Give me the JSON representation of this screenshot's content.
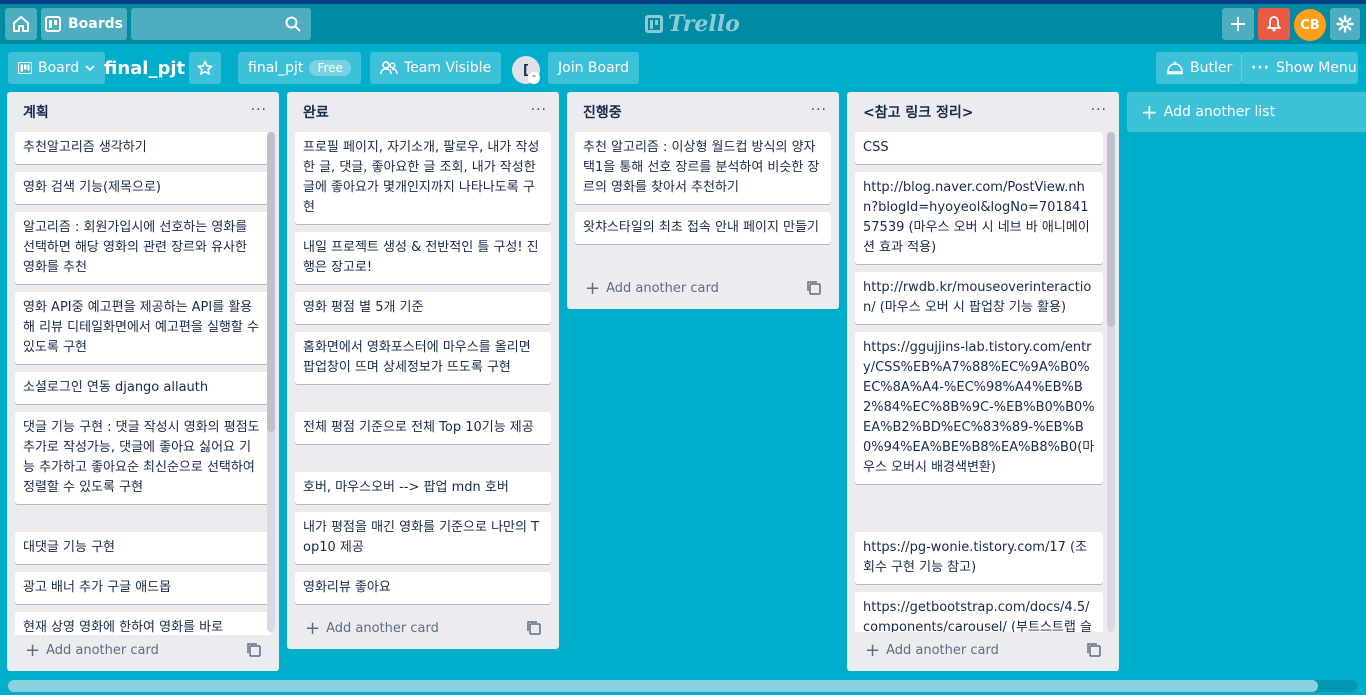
{
  "header": {
    "boards_label": "Boards",
    "search_placeholder": "",
    "logo_text": "Trello",
    "user_initials": "CB"
  },
  "boardbar": {
    "view_label": "Board",
    "board_name": "final_pjt",
    "team_label": "final_pjt",
    "plan_badge": "Free",
    "visibility_label": "Team Visible",
    "member_initial": "[",
    "join_label": "Join Board",
    "butler_label": "Butler",
    "menu_label": "Show Menu"
  },
  "lists": [
    {
      "title": "계획",
      "cards": [
        "추천알고리즘 생각하기",
        "영화 검색 기능(제목으로)",
        "알고리즘 : 회원가입시에 선호하는 영화를 선택하면 해당 영화의 관련 장르와 유사한 영화를 추천",
        "영화 API중 예고편을 제공하는 API를 활용해 리뷰 디테일화면에서 예고편을 실행할 수 있도록 구현",
        "소셜로그인 연동 django allauth",
        "댓글 기능 구현 : 댓글 작성시 영화의 평점도 추가로 작성가능, 댓글에 좋아요 싫어요 기능 추가하고 좋아요순 최신순으로 선택하여 정렬할 수 있도록 구현",
        "대댓글 기능 구현",
        "광고 배너 추가 구글 애드몹",
        "현재 상영 영화에 한하여 영화를 바로"
      ],
      "add_card_label": "Add another card"
    },
    {
      "title": "완료",
      "cards": [
        "프로필 페이지, 자기소개, 팔로우, 내가 작성한 글, 댓글, 좋아요한 글 조회, 내가 작성한 글에 좋아요가 몇개인지까지 나타나도록 구현",
        "내일 프로젝트 생성 & 전반적인 틀 구성! 진행은 장고로!",
        "영화 평점 별 5개 기준",
        "홈화면에서 영화포스터에 마우스를 올리면 팝업창이 뜨며 상세정보가 뜨도록 구현",
        "전체 평점 기준으로 전체 Top 10기능 제공",
        "호버, 마우스오버 --> 팝업 mdn 호버",
        "내가 평점을 매긴 영화를 기준으로 나만의 Top10 제공",
        "영화리뷰 좋아요"
      ],
      "add_card_label": "Add another card"
    },
    {
      "title": "진행중",
      "cards": [
        "추천 알고리즘 : 이상형 월드컵 방식의 양자 택1을 통해 선호 장르를 분석하여 비슷한 장르의 영화를 찾아서 추천하기",
        "왓챠스타일의 최초 접속 안내 페이지 만들기"
      ],
      "add_card_label": "Add another card"
    },
    {
      "title": "<참고 링크 정리>",
      "cards": [
        "CSS",
        "http://blog.naver.com/PostView.nhn?blogId=hyoyeol&logNo=70184157539 (마우스 오버 시 네브 바 애니메이션 효과 적용)",
        "http://rwdb.kr/mouseoverinteraction/ (마우스 오버 시 팝업창 기능 활용)",
        "https://ggujjins-lab.tistory.com/entry/CSS%EB%A7%88%EC%9A%B0%EC%8A%A4-%EC%98%A4%EB%B2%84%EC%8B%9C-%EB%B0%B0%EA%B2%BD%EC%83%89-%EB%B0%94%EA%BE%B8%EA%B8%B0(마우스 오버시 배경색변환)",
        "https://pg-wonie.tistory.com/17 (조회수 구현 기능 참고)",
        "https://getbootstrap.com/docs/4.5/components/carousel/ (부트스트랩 슬"
      ],
      "add_card_label": "Add another card"
    }
  ],
  "add_list_label": "Add another list",
  "colors": {
    "board_background": "#00aecc",
    "header_background": "#008ba5",
    "notification": "#eb5a46",
    "avatar": "#ff9f1a",
    "list_background": "#ebecf0"
  },
  "icons": [
    "home-icon",
    "boards-icon",
    "search-icon",
    "plus-icon",
    "bell-icon",
    "gear-icon",
    "star-icon",
    "team-icon",
    "butler-icon",
    "more-icon",
    "template-icon"
  ]
}
